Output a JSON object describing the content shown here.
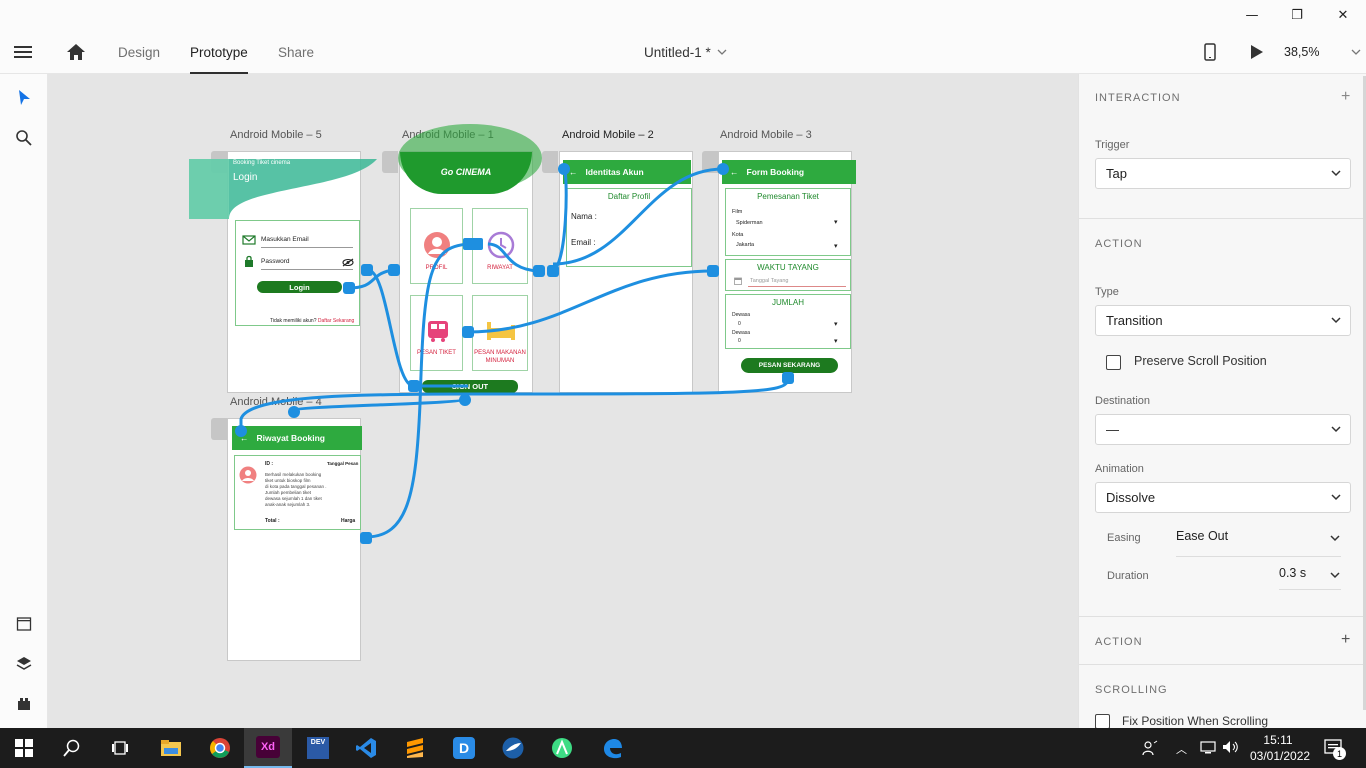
{
  "window": {
    "minimize": "—",
    "restore": "❐",
    "close": "✕"
  },
  "toolbar": {
    "tabs": [
      "Design",
      "Prototype",
      "Share"
    ],
    "active_tab": "Prototype",
    "doc_title": "Untitled-1 *",
    "zoom": "38,5%"
  },
  "canvas": {
    "artboards": {
      "a5": {
        "label": "Android Mobile – 5",
        "header_small": "Booking Tiket cinema",
        "header_title": "Login",
        "email": "Masukkan Email",
        "password": "Password",
        "login_btn": "Login",
        "footer": "Tidak memiliki akun?",
        "footer_link": "Daftar Sekarang"
      },
      "a1": {
        "label": "Android Mobile – 1",
        "title": "Go CINEMA",
        "tiles": [
          "PROFIL",
          "RIWAYAT",
          "PESAN TIKET",
          "PESAN MAKANAN MINUMAN"
        ],
        "signout": "SIGN OUT"
      },
      "a2": {
        "label": "Android Mobile – 2",
        "header": "Identitas Akun",
        "section": "Daftar Profil",
        "nama": "Nama :",
        "email": "Email :"
      },
      "a3": {
        "label": "Android Mobile – 3",
        "header": "Form Booking",
        "section": "Pemesanan Tiket",
        "film_label": "Film",
        "film_value": "Spiderman",
        "kota_label": "Kota",
        "kota_value": "Jakarta",
        "waktu": "WAKTU TAYANG",
        "tanggal": "Tanggal Tayang",
        "jumlah": "JUMLAH",
        "dewasa1": "Dewasa",
        "val1": "0",
        "dewasa2": "Dewasa",
        "val2": "0",
        "button": "PESAN SEKARANG"
      },
      "a4": {
        "label": "Android Mobile – 4",
        "header": "Riwayat Booking",
        "id": "ID :",
        "tanggal": "Tanggal Pesan",
        "desc": [
          "Berhasil melakukan booking",
          "tiket untuk bioskop film",
          "di kota pada tanggal pesanan .",
          "Jumlah pembelian tiket",
          "dewasa sejumlah 1 dan tiket",
          "anak-anak sejumlah 3."
        ],
        "total": "Total :",
        "harga": "Harga"
      }
    }
  },
  "panel": {
    "interaction": "INTERACTION",
    "trigger_label": "Trigger",
    "trigger": "Tap",
    "action": "ACTION",
    "type_label": "Type",
    "type": "Transition",
    "preserve": "Preserve Scroll Position",
    "destination_label": "Destination",
    "destination": "—",
    "animation_label": "Animation",
    "animation": "Dissolve",
    "easing_label": "Easing",
    "easing": "Ease Out",
    "duration_label": "Duration",
    "duration": "0.3 s",
    "action2": "ACTION",
    "scrolling": "SCROLLING",
    "fix_position": "Fix Position When Scrolling"
  },
  "taskbar": {
    "time": "15:11",
    "date": "03/01/2022",
    "notifications": "1",
    "icons": [
      "windows-icon",
      "search-icon",
      "task-view-icon",
      "file-explorer-icon",
      "chrome-icon",
      "adobe-xd-icon",
      "dev-cpp-icon",
      "vscode-icon",
      "sublime-icon",
      "app-d-icon",
      "app-bird-icon",
      "android-studio-icon",
      "edge-icon"
    ]
  },
  "colors": {
    "connector": "#1e8fe0",
    "green": "#2eaa3f",
    "dark_green": "#1d7a1f",
    "xd": "#ff61f6"
  }
}
